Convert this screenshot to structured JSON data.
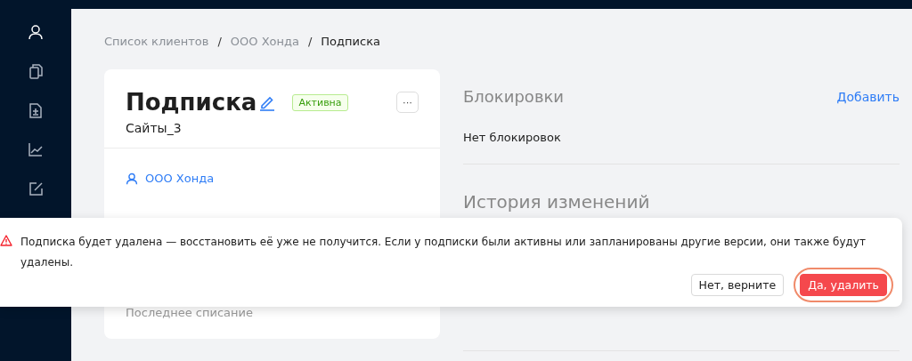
{
  "sidebar": {
    "items": [
      {
        "selected": true
      },
      {
        "selected": false
      },
      {
        "selected": false
      },
      {
        "selected": false
      },
      {
        "selected": false
      }
    ]
  },
  "breadcrumbs": [
    {
      "label": "Список клиентов",
      "current": false
    },
    {
      "label": "ООО Хонда",
      "current": false
    },
    {
      "label": "Подписка",
      "current": true
    }
  ],
  "breadcrumb_separator": "/",
  "subscription": {
    "title": "Подписка",
    "status": "Активна",
    "more": "···",
    "name": "Сайты_3",
    "client": "ООО Хонда",
    "last_charge_label": "Последнее списание"
  },
  "blocks": {
    "title": "Блокировки",
    "add": "Добавить",
    "empty": "Нет блокировок"
  },
  "history": {
    "title": "История изменений"
  },
  "confirm": {
    "message": "Подписка будет удалена — восстановить её уже не получится. Если у подписки были активны или запланированы другие версии, они также будут удалены.",
    "buttons": [
      {
        "label": "Нет, верните",
        "kind": "secondary",
        "highlighted": false
      },
      {
        "label": "Да, удалить",
        "kind": "danger",
        "highlighted": true
      }
    ]
  }
}
